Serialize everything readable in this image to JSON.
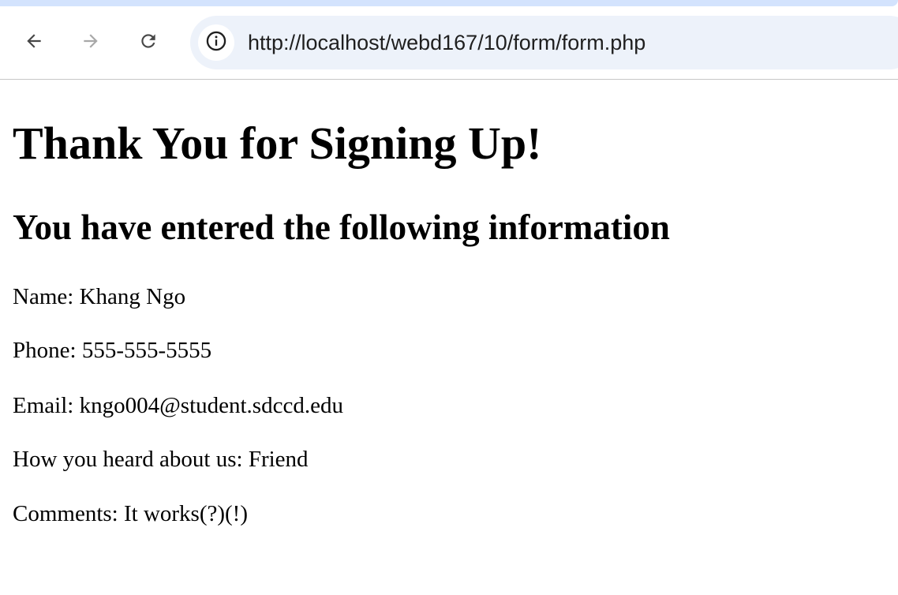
{
  "browser": {
    "url": "http://localhost/webd167/10/form/form.php",
    "icons": {
      "back": "arrow-left-icon",
      "forward": "arrow-right-icon",
      "reload": "reload-icon",
      "site_info": "info-icon"
    },
    "colors": {
      "omnibox_bg": "#edf2fa",
      "top_strip": "#d3e3fd"
    }
  },
  "page": {
    "title": "Thank You for Signing Up!",
    "subtitle": "You have entered the following information",
    "fields": [
      {
        "label": "Name:",
        "value": "Khang Ngo"
      },
      {
        "label": "Phone:",
        "value": "555-555-5555"
      },
      {
        "label": "Email:",
        "value": "kngo004@student.sdccd.edu"
      },
      {
        "label": "How you heard about us:",
        "value": "Friend"
      },
      {
        "label": "Comments:",
        "value": "It works(?)(!)"
      }
    ]
  }
}
